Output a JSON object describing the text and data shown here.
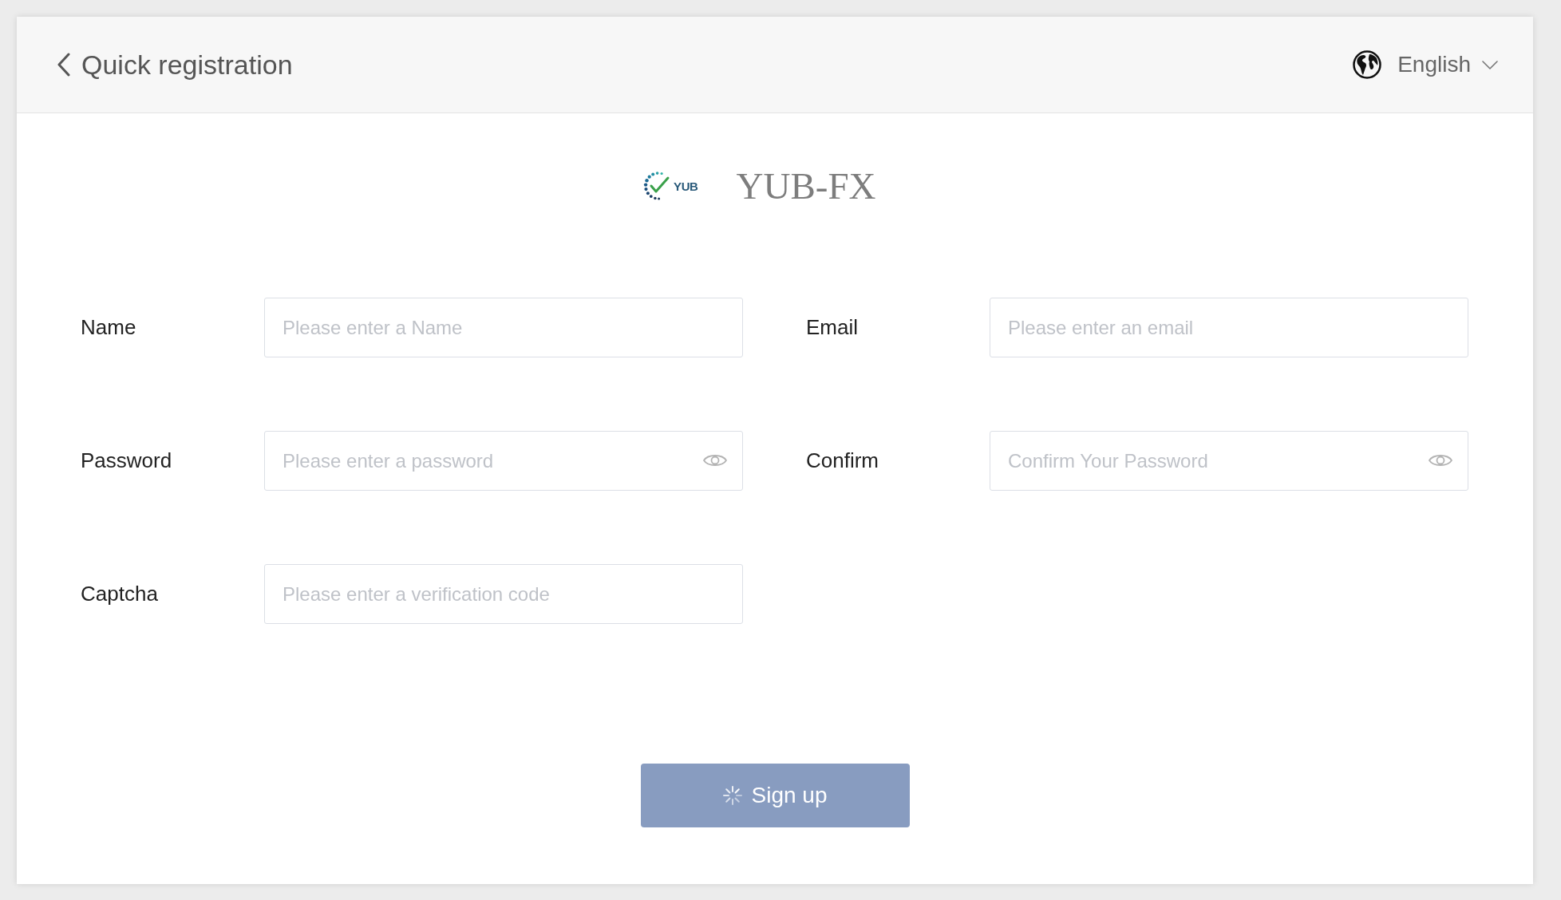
{
  "header": {
    "title": "Quick registration",
    "language": "English"
  },
  "brand": {
    "logo_text": "YUB",
    "name": "YUB-FX"
  },
  "fields": [
    {
      "label": "Name",
      "placeholder": "Please enter a Name",
      "kind": "text"
    },
    {
      "label": "Email",
      "placeholder": "Please enter an email",
      "kind": "text"
    },
    {
      "label": "Password",
      "placeholder": "Please enter a password",
      "kind": "password"
    },
    {
      "label": "Confirm",
      "placeholder": "Confirm Your Password",
      "kind": "password"
    },
    {
      "label": "Captcha",
      "placeholder": "Please enter a verification code",
      "kind": "text"
    }
  ],
  "submit": {
    "label": "Sign up",
    "loading": true
  }
}
